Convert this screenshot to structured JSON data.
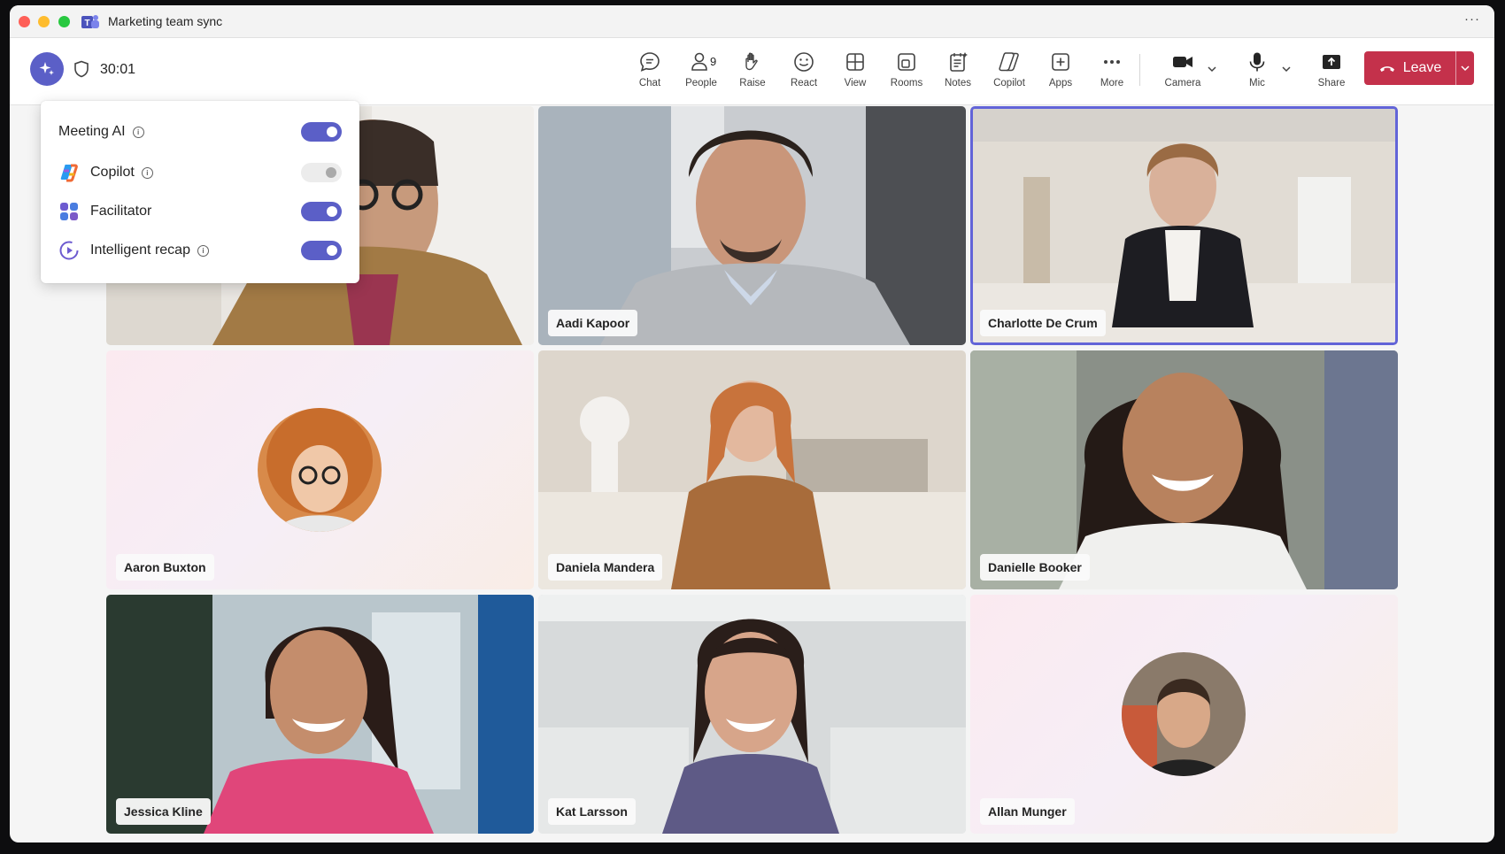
{
  "window": {
    "title": "Marketing team sync"
  },
  "meeting": {
    "timer": "30:01"
  },
  "toolbar": {
    "chat": "Chat",
    "people": "People",
    "people_count": "9",
    "raise": "Raise",
    "react": "React",
    "view": "View",
    "rooms": "Rooms",
    "notes": "Notes",
    "copilot": "Copilot",
    "apps": "Apps",
    "more": "More",
    "camera": "Camera",
    "mic": "Mic",
    "share": "Share",
    "leave": "Leave"
  },
  "ai_panel": {
    "items": [
      {
        "label": "Meeting AI",
        "enabled": true
      },
      {
        "label": "Copilot",
        "enabled": false
      },
      {
        "label": "Facilitator",
        "enabled": true
      },
      {
        "label": "Intelligent recap",
        "enabled": true
      }
    ]
  },
  "participants": [
    {
      "name": ""
    },
    {
      "name": "Aadi Kapoor"
    },
    {
      "name": "Charlotte De Crum",
      "active_speaker": true
    },
    {
      "name": "Aaron Buxton"
    },
    {
      "name": "Daniela Mandera"
    },
    {
      "name": "Danielle Booker"
    },
    {
      "name": "Jessica Kline"
    },
    {
      "name": "Kat Larsson"
    },
    {
      "name": "Allan Munger"
    }
  ],
  "colors": {
    "accent": "#5b5fc7",
    "leave": "#c4314b"
  }
}
